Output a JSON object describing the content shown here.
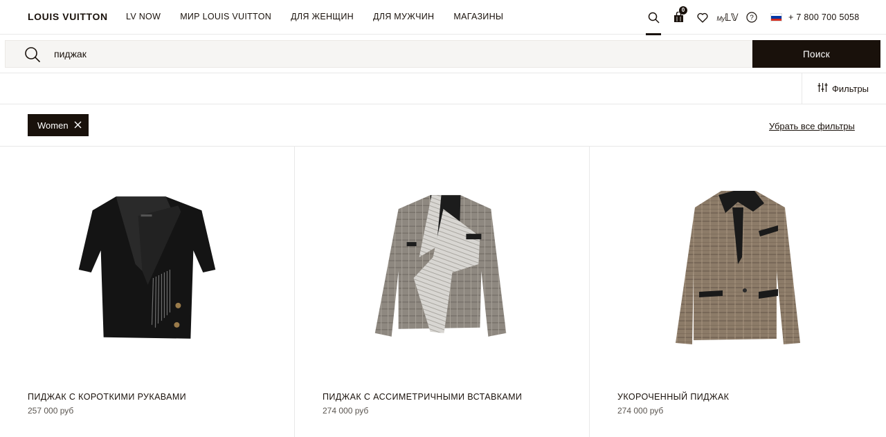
{
  "header": {
    "logo": "LOUIS VUITTON",
    "nav": [
      "LV NOW",
      "МИР LOUIS VUITTON",
      "ДЛЯ ЖЕНЩИН",
      "ДЛЯ МУЖЧИН",
      "МАГАЗИНЫ"
    ],
    "bag_count": "0",
    "myl_label": "My",
    "phone": "+ 7 800 700 5058",
    "icons": [
      "search-icon",
      "shopping-bag-icon",
      "heart-icon",
      "my-lv-icon",
      "help-icon",
      "russia-flag-icon"
    ]
  },
  "search": {
    "value": "пиджак",
    "button_label": "Поиск"
  },
  "filters": {
    "button_label": "Фильтры",
    "active_chip": "Women",
    "clear_all": "Убрать все фильтры"
  },
  "products": [
    {
      "name": "ПИДЖАК С КОРОТКИМИ РУКАВАМИ",
      "price": "257 000 руб"
    },
    {
      "name": "ПИДЖАК С АССИМЕТРИЧНЫМИ ВСТАВКАМИ",
      "price": "274 000 руб"
    },
    {
      "name": "УКОРОЧЕННЫЙ ПИДЖАК",
      "price": "274 000 руб"
    }
  ],
  "colors": {
    "brand_dark": "#19110b",
    "search_bg": "#f6f5f3",
    "divider": "#e8e8e8"
  }
}
